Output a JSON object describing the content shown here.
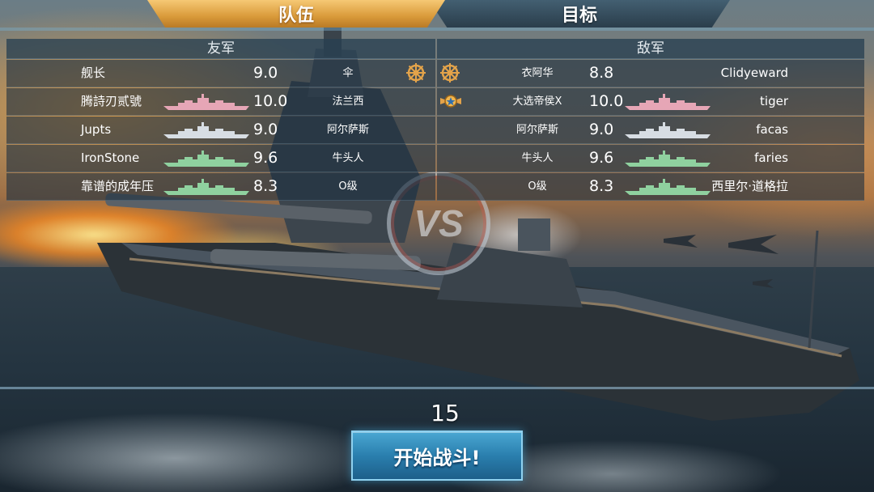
{
  "tabs": {
    "team_label": "队伍",
    "target_label": "目标"
  },
  "ally": {
    "header": "友军",
    "players": [
      {
        "name": "舰长",
        "rating": "9.0",
        "ship_type": "伞",
        "badge": "ship-wheel-icon",
        "ship_color": ""
      },
      {
        "name": "腾詩刃贰號",
        "rating": "10.0",
        "ship_type": "法兰西",
        "badge": "",
        "ship_color": "#e6a6b6"
      },
      {
        "name": "Jupts",
        "rating": "9.0",
        "ship_type": "阿尔萨斯",
        "badge": "",
        "ship_color": "#d7dde3"
      },
      {
        "name": "IronStone",
        "rating": "9.6",
        "ship_type": "牛头人",
        "badge": "",
        "ship_color": "#8fd19f"
      },
      {
        "name": "靠谱的成年压",
        "rating": "8.3",
        "ship_type": "O级",
        "badge": "",
        "ship_color": "#8fd19f"
      }
    ]
  },
  "enemy": {
    "header": "敌军",
    "players": [
      {
        "name": "Clidyeward",
        "rating": "8.8",
        "ship_type": "衣阿华",
        "badge": "ship-wheel-icon",
        "ship_color": ""
      },
      {
        "name": "tiger",
        "rating": "10.0",
        "ship_type": "大选帝侯X",
        "badge": "winged-star-icon",
        "ship_color": "#e6a6b6"
      },
      {
        "name": "facas",
        "rating": "9.0",
        "ship_type": "阿尔萨斯",
        "badge": "",
        "ship_color": "#d7dde3"
      },
      {
        "name": "faries",
        "rating": "9.6",
        "ship_type": "牛头人",
        "badge": "",
        "ship_color": "#8fd19f"
      },
      {
        "name": "西里尔·道格拉",
        "rating": "8.3",
        "ship_type": "O级",
        "badge": "",
        "ship_color": "#8fd19f"
      }
    ]
  },
  "countdown": "15",
  "start_button_label": "开始战斗!",
  "vs_label": "VS",
  "colors": {
    "tab_active": "#d99a3a",
    "start_button": "#2a7fae",
    "ship_pink": "#e6a6b6",
    "ship_white": "#d7dde3",
    "ship_green": "#8fd19f"
  }
}
